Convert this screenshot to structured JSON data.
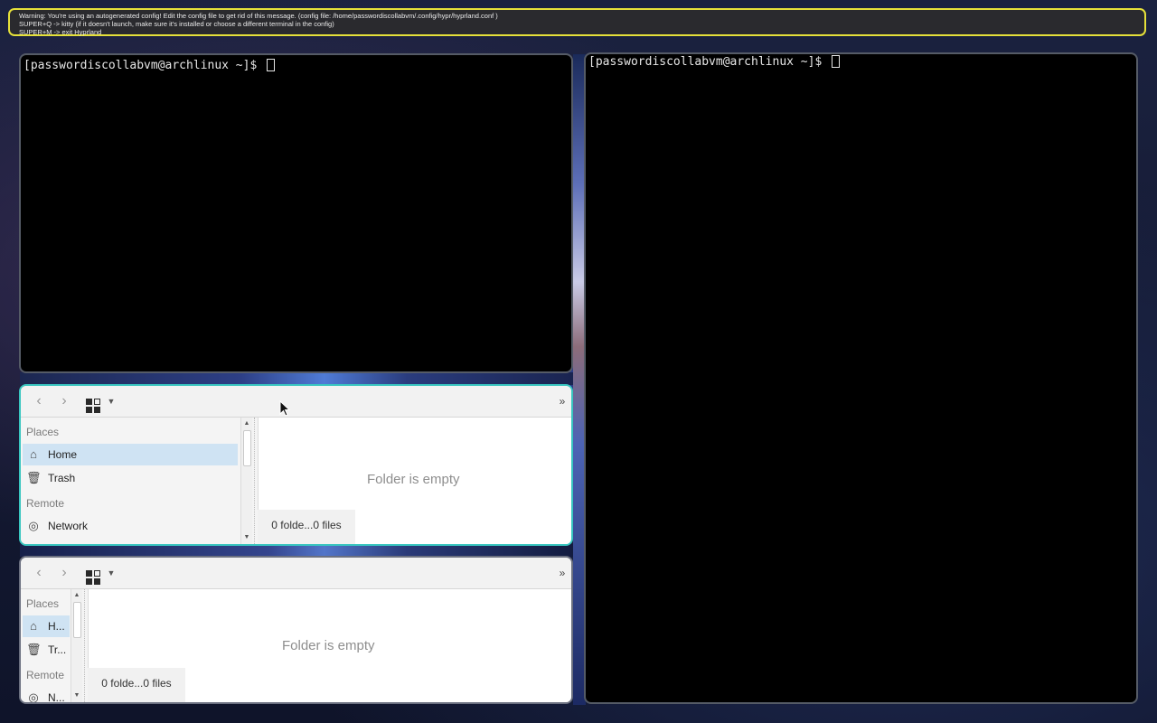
{
  "notice": {
    "lines": [
      "Warning: You're using an autogenerated config! Edit the config file to get rid of this message. (config file: /home/passwordiscollabvm/.config/hypr/hyprland.conf )",
      "SUPER+Q -> kitty (if it doesn't launch, make sure it's installed or choose a different terminal in the config)",
      "SUPER+M -> exit Hyprland"
    ]
  },
  "terminals": [
    {
      "prompt": "[passwordiscollabvm@archlinux ~]$ "
    },
    {
      "prompt": "[passwordiscollabvm@archlinux ~]$ "
    }
  ],
  "file_managers": [
    {
      "places_header": "Places",
      "remote_header": "Remote",
      "items": [
        "Home",
        "Trash",
        "Network"
      ],
      "empty_text": "Folder is empty",
      "status": "0 folde...0 files"
    },
    {
      "places_header": "Places",
      "remote_header": "Remote",
      "items": [
        "H...",
        "Tr...",
        "N..."
      ],
      "empty_text": "Folder is empty",
      "status": "0 folde...0 files"
    }
  ],
  "icons": [
    "back-arrow-icon",
    "forward-arrow-icon",
    "icon-view-icon",
    "dropdown-arrow-icon",
    "overflow-icon",
    "home-icon",
    "trash-icon",
    "network-icon"
  ],
  "colors": {
    "active_border": "#39c6c0",
    "notice_border": "#e5e03a",
    "selection": "#cfe3f3"
  }
}
